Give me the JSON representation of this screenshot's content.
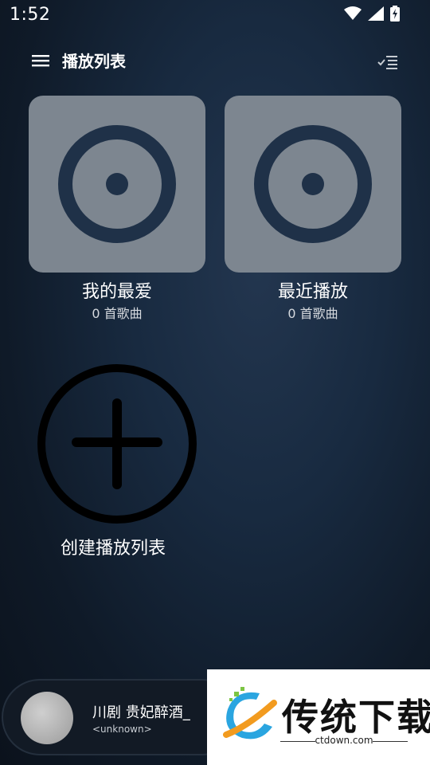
{
  "status": {
    "time": "1:52"
  },
  "header": {
    "title": "播放列表",
    "menu_icon": "hamburger-icon",
    "sort_icon": "checklist-sort-icon"
  },
  "playlists": [
    {
      "title": "我的最爱",
      "subtitle": "0 首歌曲",
      "icon": "disc-icon"
    },
    {
      "title": "最近播放",
      "subtitle": "0 首歌曲",
      "icon": "disc-icon"
    }
  ],
  "create": {
    "label": "创建播放列表",
    "icon": "add-circle-icon"
  },
  "player": {
    "title": "川剧 贵妃醉酒_",
    "artist": "<unknown>"
  },
  "watermark": {
    "brand": "传统下载",
    "url": "ctdown.com"
  },
  "colors": {
    "card": "#7d8690",
    "disc": "#1f3148",
    "accent": "#000000"
  }
}
